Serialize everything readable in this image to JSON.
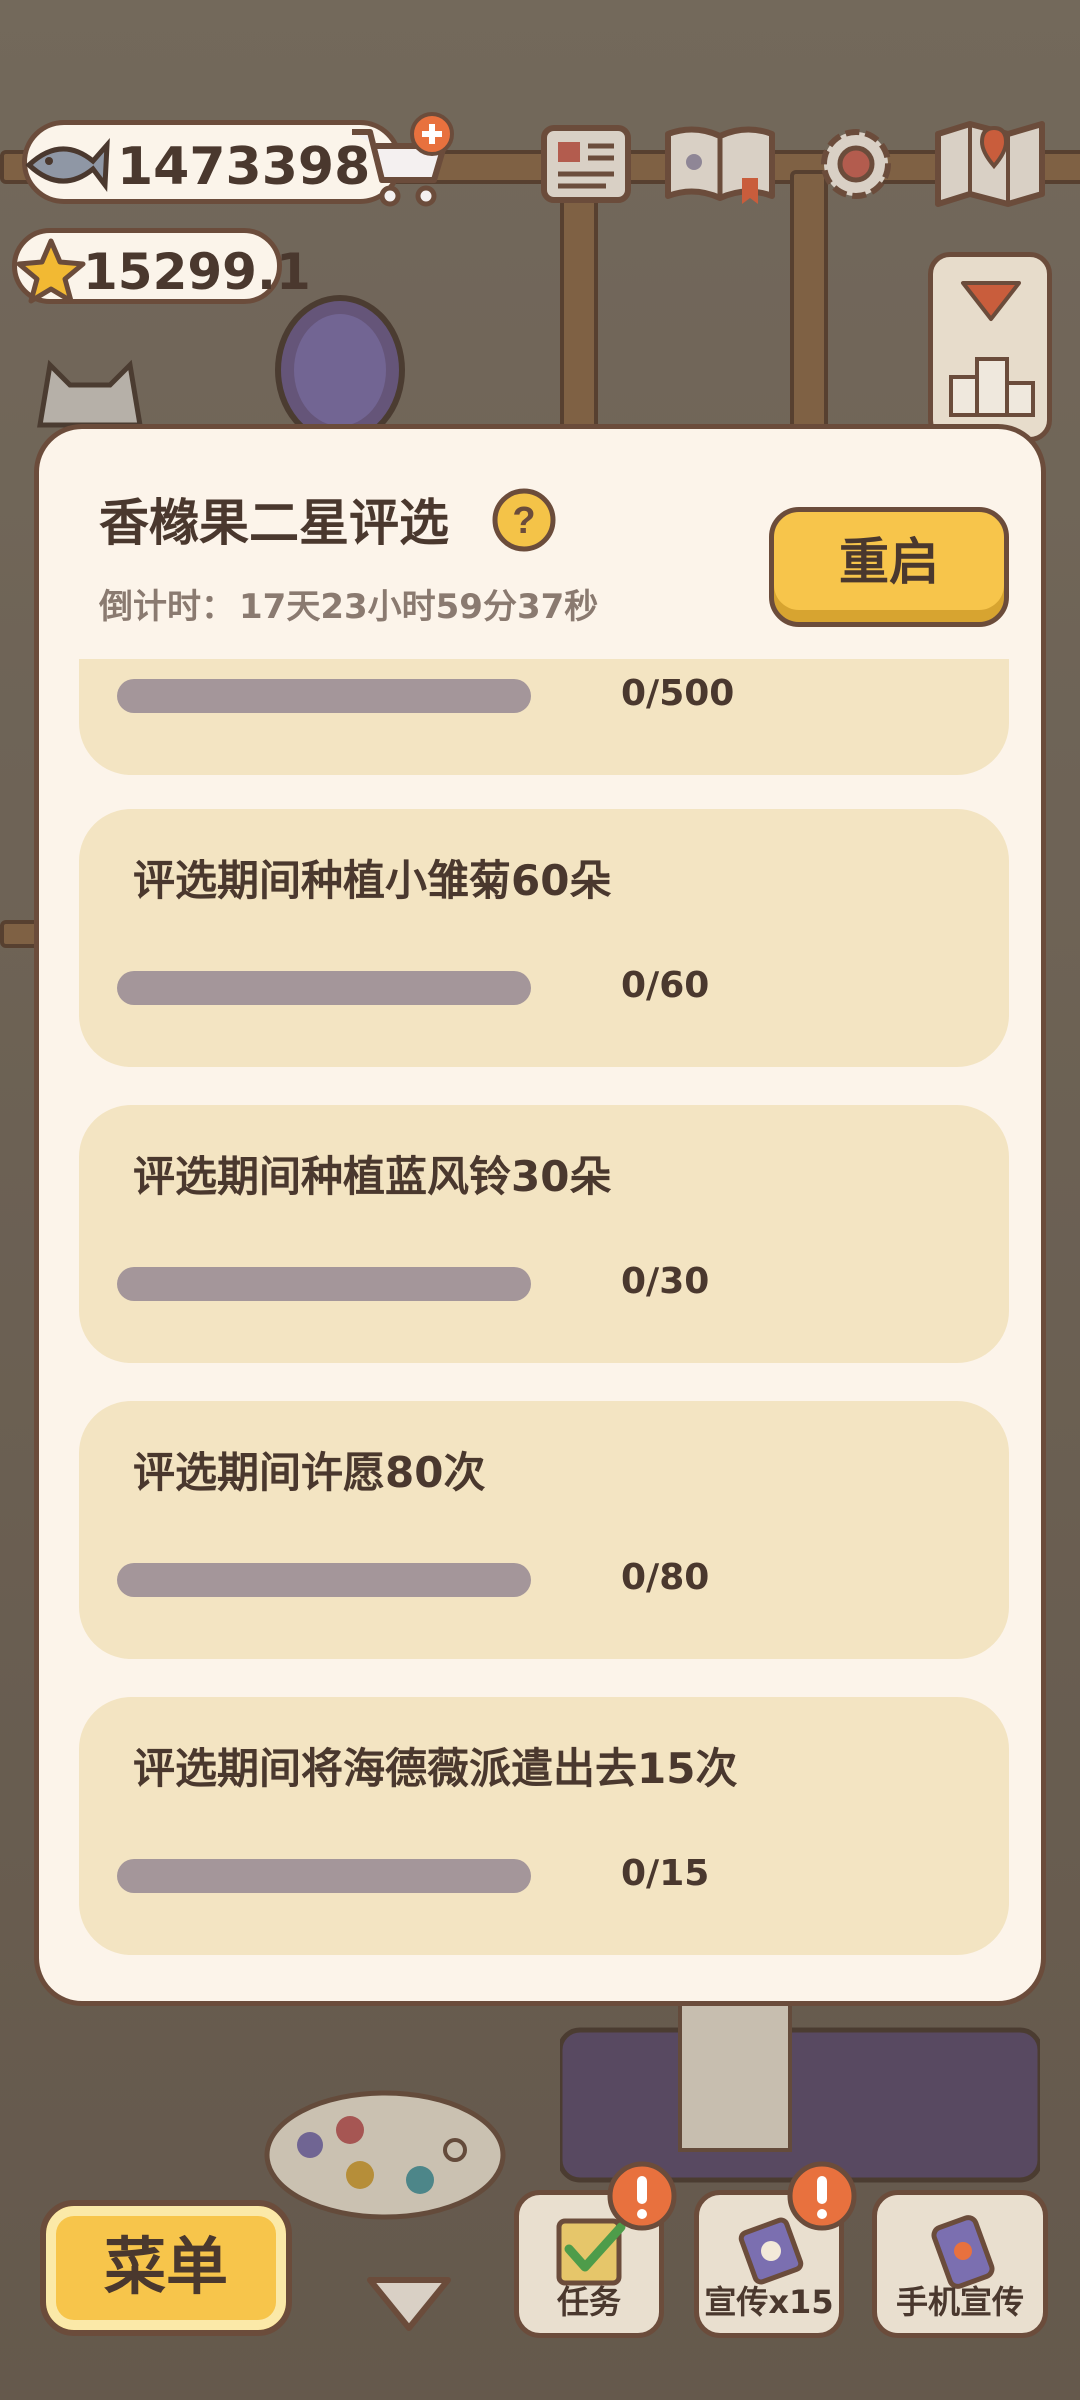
{
  "currency": {
    "fish": "1473398",
    "star": "15299.1"
  },
  "modal": {
    "title": "香橼果二星评选",
    "countdown_label": "倒计时：",
    "countdown_value": "17天23小时59分37秒",
    "restart_label": "重启"
  },
  "tasks": [
    {
      "label": "",
      "progress": "0/500",
      "fraction": 0
    },
    {
      "label": "评选期间种植小雏菊60朵",
      "progress": "0/60",
      "fraction": 0
    },
    {
      "label": "评选期间种植蓝风铃30朵",
      "progress": "0/30",
      "fraction": 0
    },
    {
      "label": "评选期间许愿80次",
      "progress": "0/80",
      "fraction": 0
    },
    {
      "label": "评选期间将海德薇派遣出去15次",
      "progress": "0/15",
      "fraction": 0
    }
  ],
  "bottom": {
    "menu_label": "菜单",
    "tasks_label": "任务",
    "promo_label": "宣传x15",
    "phone_promo_label": "手机宣传"
  },
  "colors": {
    "panel": "#fcf4ea",
    "card": "#f3e4c2",
    "accent_yellow": "#f7c54b",
    "alert_orange": "#e8713e",
    "border_brown": "#6b4c3b"
  }
}
